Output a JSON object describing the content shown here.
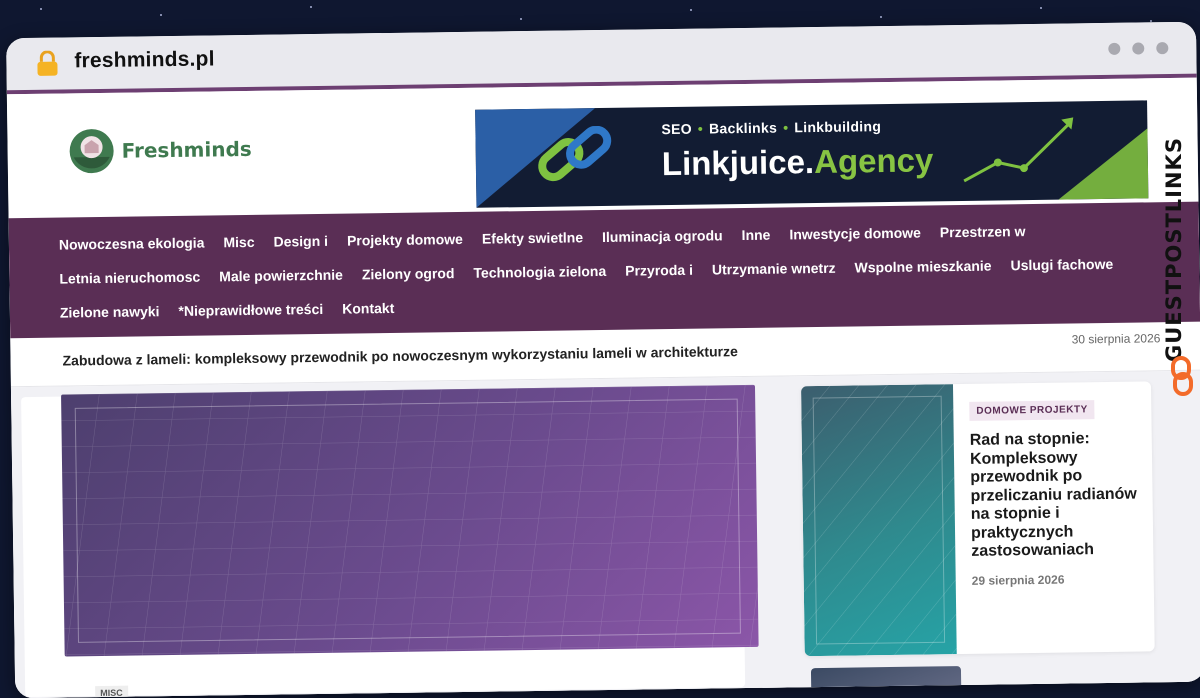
{
  "browser": {
    "url": "freshminds.pl"
  },
  "site": {
    "logo_text": "Freshminds",
    "banner": {
      "tagline": [
        "SEO",
        "Backlinks",
        "Linkbuilding"
      ],
      "title_main": "Linkjuice.",
      "title_accent": "Agency"
    },
    "nav": [
      "Nowoczesna ekologia",
      "Misc",
      "Design i",
      "Projekty domowe",
      "Efekty swietlne",
      "Iluminacja ogrodu",
      "Inne",
      "Inwestycje domowe",
      "Przestrzen w",
      "Letnia nieruchomosc",
      "Male powierzchnie",
      "Zielony ogrod",
      "Technologia zielona",
      "Przyroda i",
      "Utrzymanie wnetrz",
      "Wspolne mieszkanie",
      "Uslugi fachowe",
      "Zielone nawyki",
      "*Nieprawidłowe treści",
      "Kontakt"
    ],
    "ticker": {
      "title": "Zabudowa z lameli: kompleksowy przewodnik po nowoczesnym wykorzystaniu lameli w architekturze",
      "date": "30 sierpnia 2026"
    },
    "main_badge": "MISC",
    "side_post": {
      "category": "DOMOWE PROJEKTY",
      "title": "Rad na stopnie: Kompleksowy przewodnik po przeliczaniu radianów na stopnie i praktycznych zastosowaniach",
      "date": "29 sierpnia 2026"
    }
  },
  "watermark": {
    "text": "GUESTPOSTLINKS"
  },
  "colors": {
    "nav_bg": "#5a2e55",
    "brand_green": "#3f7a4f",
    "banner_bg": "#121c33",
    "banner_accent": "#88c443"
  }
}
